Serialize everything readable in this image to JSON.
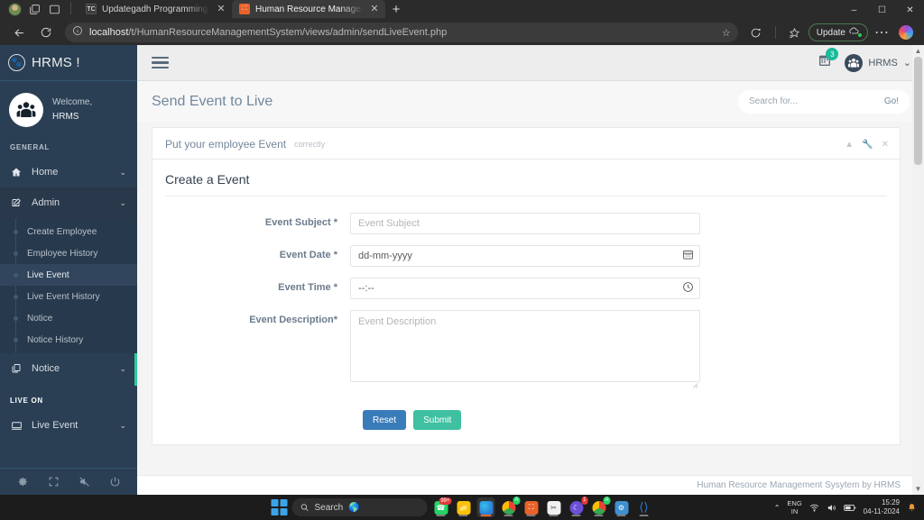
{
  "browser": {
    "tabs": [
      {
        "title": "Updategadh Programming - Upd",
        "favicon": "vs-code-icon",
        "active": false
      },
      {
        "title": "Human Resource Management Sy",
        "favicon": "hrms-icon",
        "active": true
      }
    ],
    "new_tab_label": "+",
    "window_controls": {
      "minimize": "–",
      "maximize": "❐",
      "close": "✕"
    },
    "url_host": "localhost",
    "url_path": "/t/HumanResourceManagementSystem/views/admin/sendLiveEvent.php",
    "update_label": "Update",
    "icons": {
      "back": "back-arrow-icon",
      "refresh": "refresh-icon",
      "info": "info-circle-icon",
      "favorite": "star-icon",
      "split": "split-screen-icon",
      "collections": "collections-icon",
      "settings": "ellipsis-icon",
      "copilot": "copilot-icon"
    }
  },
  "sidebar": {
    "brand": "HRMS !",
    "brand_icon": "paw-badge-icon",
    "welcome_label": "Welcome,",
    "user_name": "HRMS",
    "avatar_icon": "group-users-icon",
    "sections": [
      {
        "title": "GENERAL",
        "items": [
          {
            "label": "Home",
            "icon": "home-icon",
            "caret": "⌄",
            "active": false,
            "children": []
          },
          {
            "label": "Admin",
            "icon": "edit-square-icon",
            "caret": "⌄",
            "active": true,
            "children": [
              {
                "label": "Create Employee",
                "active": false
              },
              {
                "label": "Employee History",
                "active": false
              },
              {
                "label": "Live Event",
                "active": true
              },
              {
                "label": "Live Event History",
                "active": false
              },
              {
                "label": "Notice",
                "active": false
              },
              {
                "label": "Notice History",
                "active": false
              }
            ]
          },
          {
            "label": "Notice",
            "icon": "copy-layers-icon",
            "caret": "⌄",
            "active": false,
            "children": []
          }
        ]
      },
      {
        "title": "LIVE ON",
        "items": [
          {
            "label": "Live Event",
            "icon": "monitor-icon",
            "caret": "⌄",
            "active": false,
            "children": []
          }
        ]
      }
    ],
    "footer_icons": [
      "gear-icon",
      "fullscreen-icon",
      "volume-mute-icon",
      "power-icon"
    ],
    "accent_color": "#2ecc9b",
    "background_color": "#2a3f54"
  },
  "topnav": {
    "menu_toggle_icon": "hamburger-icon",
    "calendar_icon": "calendar-icon",
    "calendar_badge": "3",
    "user_avatar_icon": "group-users-icon",
    "user_label": "HRMS",
    "user_caret": "⌄"
  },
  "page": {
    "title": "Send Event to Live",
    "search": {
      "placeholder": "Search for...",
      "button": "Go!"
    }
  },
  "card": {
    "heading": "Put your employee Event",
    "subheading": "correctly",
    "tools": [
      "chevron-up-icon",
      "wrench-icon",
      "close-icon"
    ],
    "form_title": "Create a Event",
    "fields": [
      {
        "label": "Event Subject *",
        "placeholder": "Event Subject",
        "value": "",
        "type": "text",
        "icon": ""
      },
      {
        "label": "Event Date *",
        "placeholder": "dd-mm-yyyy",
        "value": "dd-mm-yyyy",
        "type": "date",
        "icon": "calendar-icon"
      },
      {
        "label": "Event Time *",
        "placeholder": "--:--",
        "value": "--:--",
        "type": "time",
        "icon": "clock-icon"
      },
      {
        "label": "Event Description*",
        "placeholder": "Event Description",
        "value": "",
        "type": "textarea",
        "icon": ""
      }
    ],
    "buttons": {
      "reset": "Reset",
      "submit": "Submit"
    },
    "reset_color": "#3a7cba",
    "submit_color": "#3fc0a0"
  },
  "footer": {
    "text": "Human Resource Management Sysytem by HRMS"
  },
  "taskbar": {
    "start_icon": "windows-start-icon",
    "search_placeholder": "Search",
    "apps": [
      {
        "name": "whatsapp-icon",
        "glyph": "✆",
        "color": "#25d366",
        "badge": "99+",
        "running": false,
        "active": false
      },
      {
        "name": "file-explorer-icon",
        "glyph": "",
        "color": "#ffc107",
        "badge": "",
        "running": true,
        "active": false
      },
      {
        "name": "microsoft-edge-icon",
        "glyph": "",
        "color": "#2b7cd3",
        "badge": "",
        "running": true,
        "active": true
      },
      {
        "name": "chrome-icon",
        "glyph": "",
        "color": "#4285f4",
        "badge": "A",
        "running": true,
        "active": false
      },
      {
        "name": "hrms-app-icon",
        "glyph": "⌘",
        "color": "#e8622a",
        "badge": "",
        "running": true,
        "active": false
      },
      {
        "name": "snipping-tool-icon",
        "glyph": "✂",
        "color": "#e8e8e8",
        "badge": "",
        "running": true,
        "active": false
      },
      {
        "name": "moon-app-icon",
        "glyph": "☾",
        "color": "#6c4fd6",
        "badge": "1",
        "running": true,
        "active": false
      },
      {
        "name": "chrome-alt-icon",
        "glyph": "",
        "color": "#4285f4",
        "badge": "A",
        "running": true,
        "active": false
      },
      {
        "name": "settings-gear-icon",
        "glyph": "⚙",
        "color": "#3f8fd0",
        "badge": "",
        "running": true,
        "active": false
      },
      {
        "name": "vs-code-icon",
        "glyph": "⬡",
        "color": "#2d7fd3",
        "badge": "",
        "running": true,
        "active": false
      }
    ],
    "tray": {
      "chevron": "⌃",
      "lang_line1": "ENG",
      "lang_line2": "IN",
      "wifi_icon": "wifi-icon",
      "volume_icon": "volume-icon",
      "battery_icon": "battery-icon",
      "time": "15:29",
      "date": "04-11-2024",
      "notification_icon": "bell-icon"
    }
  }
}
